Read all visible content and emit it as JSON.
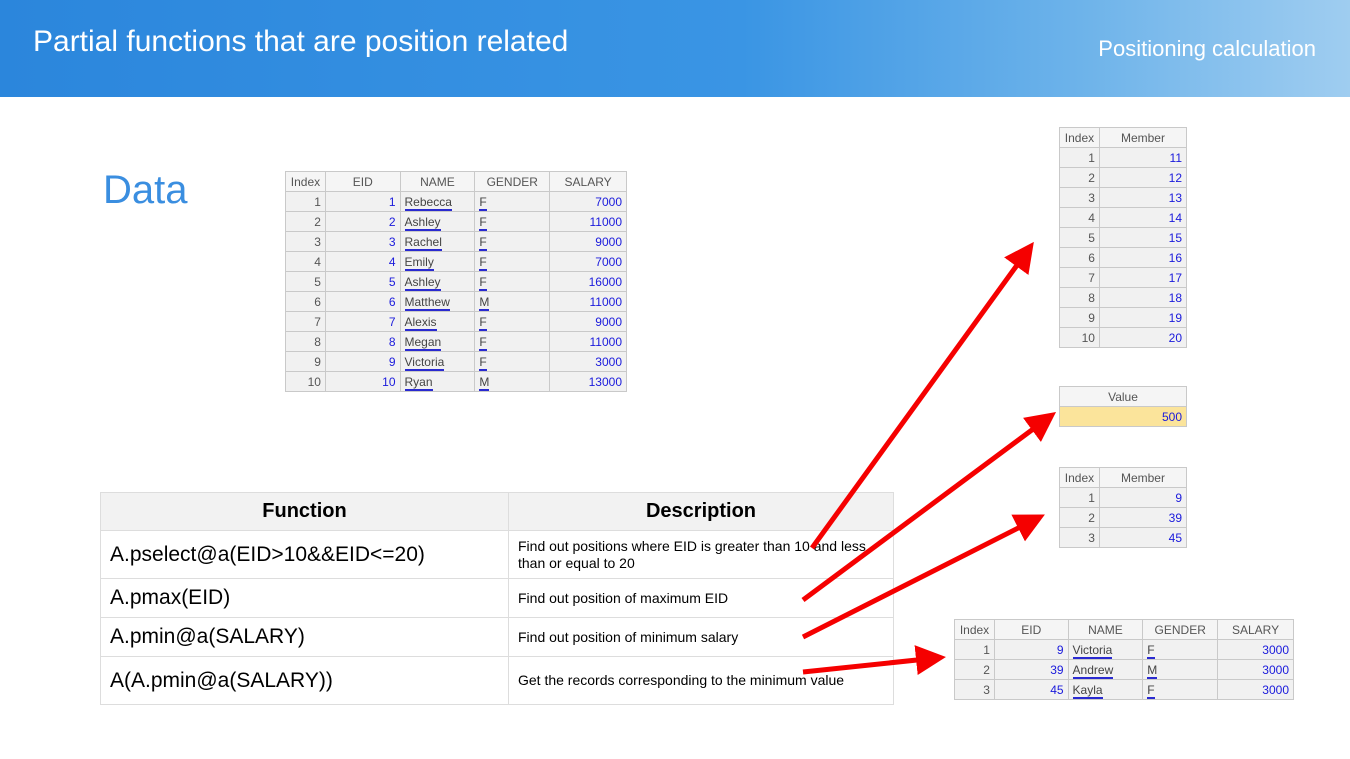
{
  "header": {
    "title": "Partial functions that are position related",
    "subtitle": "Positioning calculation"
  },
  "data_label": "Data",
  "data_table": {
    "columns": [
      "Index",
      "EID",
      "NAME",
      "GENDER",
      "SALARY"
    ],
    "rows": [
      [
        "1",
        "1",
        "Rebecca",
        "F",
        "7000"
      ],
      [
        "2",
        "2",
        "Ashley",
        "F",
        "11000"
      ],
      [
        "3",
        "3",
        "Rachel",
        "F",
        "9000"
      ],
      [
        "4",
        "4",
        "Emily",
        "F",
        "7000"
      ],
      [
        "5",
        "5",
        "Ashley",
        "F",
        "16000"
      ],
      [
        "6",
        "6",
        "Matthew",
        "M",
        "11000"
      ],
      [
        "7",
        "7",
        "Alexis",
        "F",
        "9000"
      ],
      [
        "8",
        "8",
        "Megan",
        "F",
        "11000"
      ],
      [
        "9",
        "9",
        "Victoria",
        "F",
        "3000"
      ],
      [
        "10",
        "10",
        "Ryan",
        "M",
        "13000"
      ]
    ]
  },
  "pselect_result": {
    "columns": [
      "Index",
      "Member"
    ],
    "rows": [
      [
        "1",
        "11"
      ],
      [
        "2",
        "12"
      ],
      [
        "3",
        "13"
      ],
      [
        "4",
        "14"
      ],
      [
        "5",
        "15"
      ],
      [
        "6",
        "16"
      ],
      [
        "7",
        "17"
      ],
      [
        "8",
        "18"
      ],
      [
        "9",
        "19"
      ],
      [
        "10",
        "20"
      ]
    ]
  },
  "pmax_result": {
    "column": "Value",
    "value": "500"
  },
  "pmin_result": {
    "columns": [
      "Index",
      "Member"
    ],
    "rows": [
      [
        "1",
        "9"
      ],
      [
        "2",
        "39"
      ],
      [
        "3",
        "45"
      ]
    ]
  },
  "records_result": {
    "columns": [
      "Index",
      "EID",
      "NAME",
      "GENDER",
      "SALARY"
    ],
    "rows": [
      [
        "1",
        "9",
        "Victoria",
        "F",
        "3000"
      ],
      [
        "2",
        "39",
        "Andrew",
        "M",
        "3000"
      ],
      [
        "3",
        "45",
        "Kayla",
        "F",
        "3000"
      ]
    ]
  },
  "functions": {
    "headers": [
      "Function",
      "Description"
    ],
    "rows": [
      [
        "A.pselect@a(EID>10&&EID<=20)",
        " Find out positions where EID is greater than 10 and less than or equal to 20"
      ],
      [
        "A.pmax(EID)",
        "Find out position of maximum EID"
      ],
      [
        "A.pmin@a(SALARY)",
        "Find out position of minimum salary"
      ],
      [
        "A(A.pmin@a(SALARY))",
        "Get the records corresponding to the minimum value"
      ]
    ]
  },
  "colors": {
    "accent": "#3a8ee0",
    "arrow": "#f50000"
  }
}
